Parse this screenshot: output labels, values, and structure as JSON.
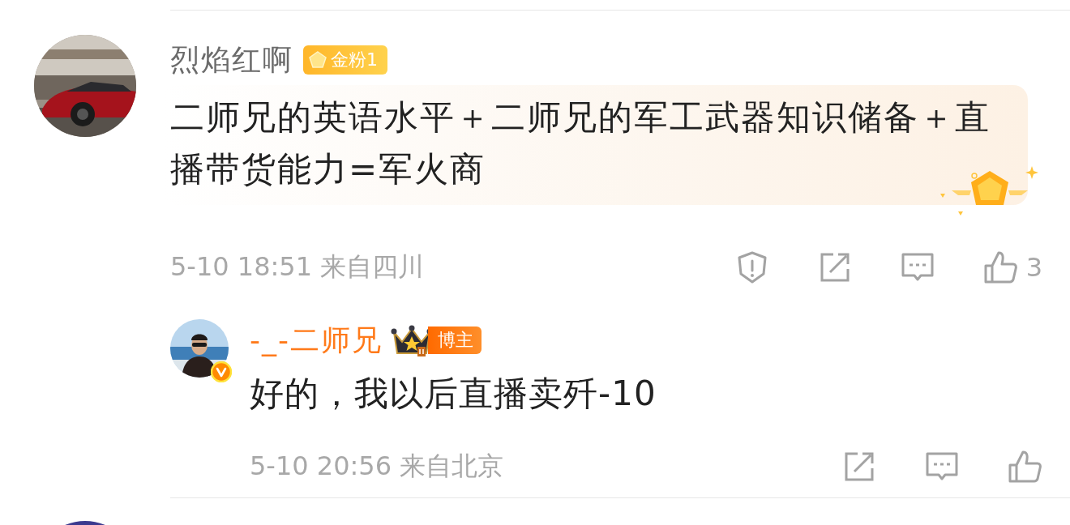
{
  "comment": {
    "author": {
      "name": "烈焰红啊",
      "badge": "金粉1"
    },
    "text": "二师兄的英语水平＋二师兄的军工武器知识储备＋直播带货能力=军火商",
    "time": "5-10 18:51",
    "location": "来自四川",
    "actions": [
      {
        "kind": "report"
      },
      {
        "kind": "share"
      },
      {
        "kind": "comment"
      },
      {
        "kind": "like",
        "count": "3"
      }
    ]
  },
  "reply": {
    "author": {
      "name": "-_-二师兄",
      "role_badge": "博主",
      "verified": true
    },
    "text": "好的，我以后直播卖歼-10",
    "time": "5-10 20:56",
    "location": "来自北京",
    "actions": [
      {
        "kind": "share"
      },
      {
        "kind": "comment"
      },
      {
        "kind": "like"
      }
    ]
  }
}
